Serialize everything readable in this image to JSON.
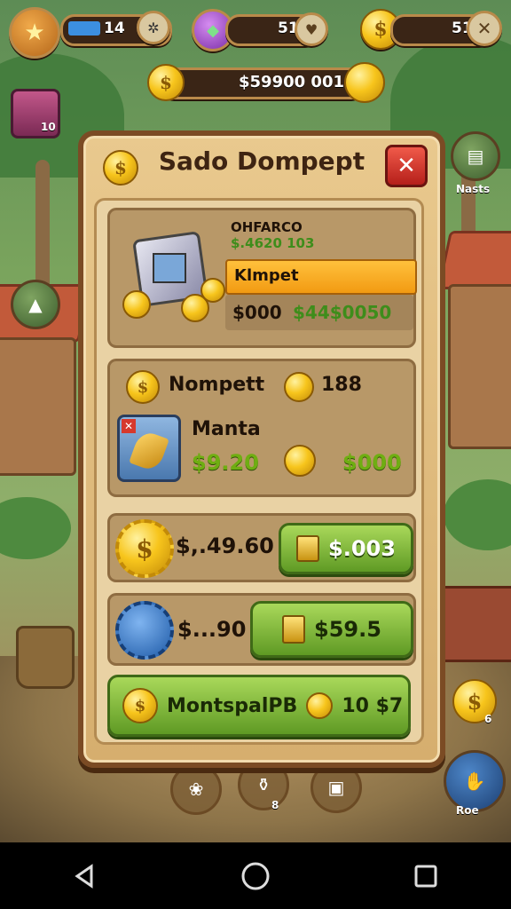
{
  "hud": {
    "xp_value": "14",
    "gems_value": "51",
    "coins_value": "51",
    "main_balance": "$59900  001"
  },
  "side": {
    "right_label_top": "Nasts",
    "bag_badge": "10",
    "right_bottom_badge": "6",
    "profile_label": "Roe"
  },
  "modal": {
    "title": "Sado Dompept",
    "close_symbol": "✕",
    "offer": {
      "header": "OHFARCO",
      "subheader": "$.4620 103",
      "tag": "Klmpet",
      "price_old": "$000",
      "price_new": "$44$0050"
    },
    "wallet": {
      "row1_label": "Nompett",
      "row1_value": "188",
      "row2_label": "Manta",
      "row2_value_left": "$9.20",
      "row2_value_right": "$000"
    },
    "deal1": {
      "amount": "$,.49.60",
      "button_label": "$.003"
    },
    "deal2": {
      "amount": "$...90",
      "button_label": "$59.5"
    },
    "footer": {
      "label": "MontspalPB",
      "value": "10 $7"
    }
  },
  "bottom_icons": {
    "middle_badge": "8"
  },
  "colors": {
    "modal_border": "#7b4b24",
    "accent_green": "#6fae12",
    "close_red": "#d6392d",
    "coin_gold": "#f7c51c"
  }
}
